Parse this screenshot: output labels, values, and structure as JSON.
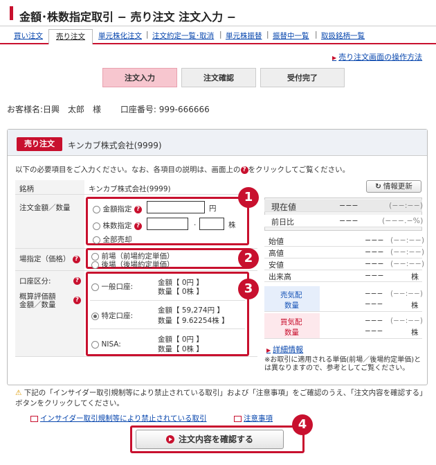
{
  "header": {
    "title": "金額･株数指定取引 − 売り注文 注文入力 −"
  },
  "tabs": [
    "買い注文",
    "売り注文",
    "単元株化注文",
    "注文約定一覧･取消",
    "単元株振替",
    "振替中一覧",
    "取扱銘柄一覧"
  ],
  "help_link": "売り注文画面の操作方法",
  "steps": [
    "注文入力",
    "注文確認",
    "受付完了"
  ],
  "customer": {
    "name_label": "お客様名:",
    "name": "日興　太郎　様",
    "account_label": "口座番号:",
    "account": "999-666666"
  },
  "panel": {
    "badge": "売り注文",
    "company": "キンカブ株式会社(9999)"
  },
  "instruction_pre": "以下の必要項目をご入力ください。なお、各項目の説明は、画面上の",
  "instruction_post": "をクリックしてご覧ください。",
  "form": {
    "security_label": "銘柄",
    "security_value": "キンカブ株式会社(9999)",
    "refresh_button": "情報更新",
    "amount_label": "注文金額／数量",
    "opt_amount": "金額指定",
    "yen": "円",
    "opt_shares": "株数指定",
    "dot": ".",
    "kabu": "株",
    "opt_all": "全部売却",
    "market_label": "場指定（価格）",
    "market_opt1": "前場（前場約定単価）",
    "market_opt2": "後場（後場約定単価）",
    "account_label": "口座区分:",
    "eval_label1": "概算評価額",
    "eval_label2": "金額／数量",
    "acct_general": "一般口座:",
    "acct_general_amt": "金額【 0円 】",
    "acct_general_qty": "数量【 0株 】",
    "acct_specific": "特定口座:",
    "acct_specific_amt": "金額【 59,274円 】",
    "acct_specific_qty": "数量【 9.62254株 】",
    "acct_nisa": "NISA:",
    "acct_nisa_amt": "金額【 0円 】",
    "acct_nisa_qty": "数量【 0株 】"
  },
  "quote": {
    "current_label": "現在値",
    "current_val": "−−−",
    "current_paren": "(−−:−−)",
    "prev_label": "前日比",
    "prev_val": "−−−",
    "prev_paren": "(−−−.−%)",
    "open_label": "始値",
    "open_val": "−−−",
    "open_paren": "(−−:−−)",
    "high_label": "高値",
    "high_val": "−−−",
    "high_paren": "(−−:−−)",
    "low_label": "安値",
    "low_val": "−−−",
    "low_paren": "(−−:−−)",
    "volume_label": "出来高",
    "volume_val": "−−−",
    "volume_unit": "株",
    "ask_label1": "売気配",
    "ask_label2": "数量",
    "ask_val": "−−−",
    "ask_paren": "(−−:−−)",
    "ask_qty": "−−−",
    "ask_unit": "株",
    "bid_label1": "買気配",
    "bid_label2": "数量",
    "bid_val": "−−−",
    "bid_paren": "(−−:−−)",
    "bid_qty": "−−−",
    "bid_unit": "株"
  },
  "detail_link": "詳細情報",
  "note": "※お取引に適用される単価(前場／後場約定単価)とは異なりますので、参考としてご覧ください。",
  "warning": "下記の「インサイダー取引規制等により禁止されている取引」および「注意事項」をご確認のうえ、「注文内容を確認する」ボタンをクリックしてください。",
  "links": {
    "insider": "インサイダー取引規制等により禁止されている取引",
    "caution": "注意事項"
  },
  "confirm_button": "注文内容を確認する",
  "markers": [
    "1",
    "2",
    "3",
    "4"
  ],
  "colors": {
    "accent": "#c8102e",
    "link": "#0645ad"
  }
}
